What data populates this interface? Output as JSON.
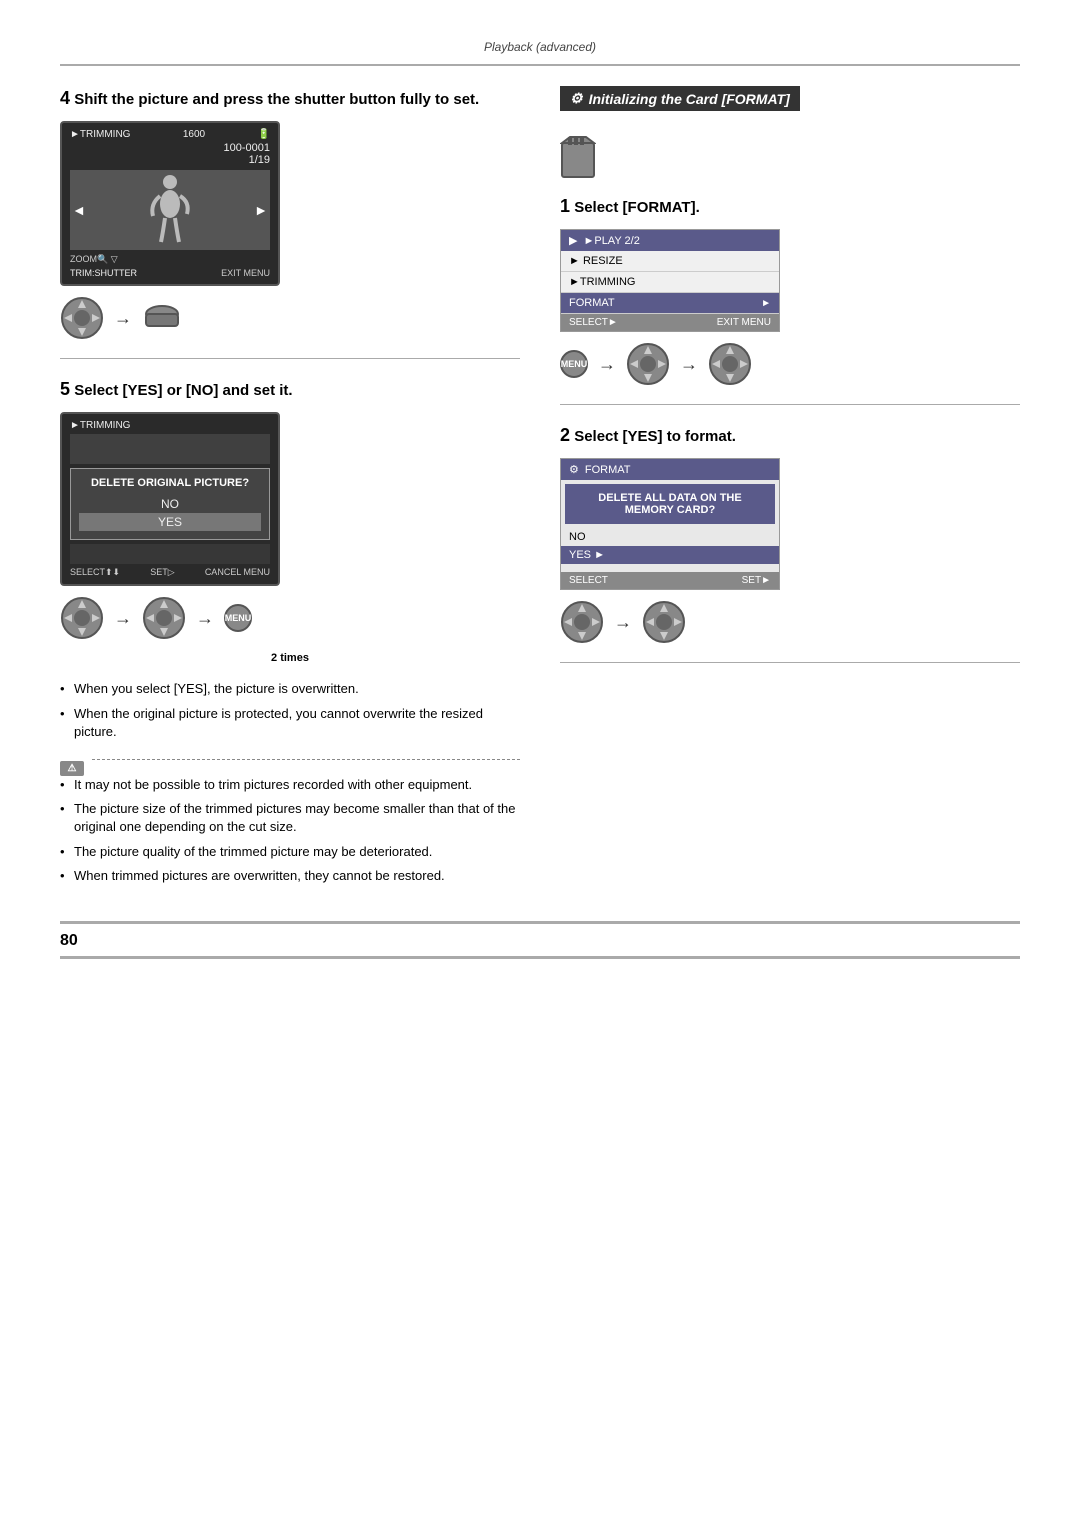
{
  "page": {
    "caption": "Playback (advanced)",
    "page_number": "80"
  },
  "left_section": {
    "step4": {
      "heading": "Shift the picture and press the shutter button fully to set.",
      "screen1": {
        "top_label": "►TRIMMING",
        "iso": "1600",
        "counter": "100-0001",
        "fraction": "1/19",
        "zoom_label": "ZOOM",
        "trim_shutter": "TRIM:SHUTTER",
        "exit_label": "EXIT MENU"
      }
    },
    "step5": {
      "heading": "Select [YES] or [NO] and set it.",
      "screen2": {
        "top_label": "►TRIMMING",
        "dialog_title": "DELETE ORIGINAL PICTURE?",
        "option_no": "NO",
        "option_yes": "YES",
        "bottom_left": "SELECT",
        "bottom_mid": "SET",
        "bottom_right": "CANCEL MENU"
      },
      "times_label": "2 times"
    },
    "notes": [
      "When you select [YES], the picture is overwritten.",
      "When the original picture is protected, you cannot overwrite the resized picture."
    ],
    "info_notes": [
      "It may not be possible to trim pictures recorded with other equipment.",
      "The picture size of the trimmed pictures may become smaller than that of the original one depending on the cut size.",
      "The picture quality of the trimmed picture may be deteriorated.",
      "When trimmed pictures are overwritten, they cannot be restored."
    ]
  },
  "right_section": {
    "section_title": "Initializing the Card [FORMAT]",
    "step1": {
      "heading": "Select [FORMAT].",
      "menu_screen": {
        "header": "►PLAY 2/2",
        "items": [
          {
            "label": "► RESIZE",
            "selected": false
          },
          {
            "label": "►TRIMMING",
            "selected": false
          },
          {
            "label": "FORMAT",
            "selected": true,
            "arrow": "►"
          }
        ],
        "footer_left": "SELECT►",
        "footer_right": "EXIT MENU"
      }
    },
    "step2": {
      "heading": "Select [YES] to format.",
      "format_screen": {
        "header": "FORMAT",
        "dialog_title": "DELETE ALL DATA ON THE MEMORY CARD?",
        "option_no": "NO",
        "option_yes": "YES",
        "yes_arrow": "►",
        "footer_left": "SELECT",
        "footer_right": "SET►"
      }
    }
  }
}
